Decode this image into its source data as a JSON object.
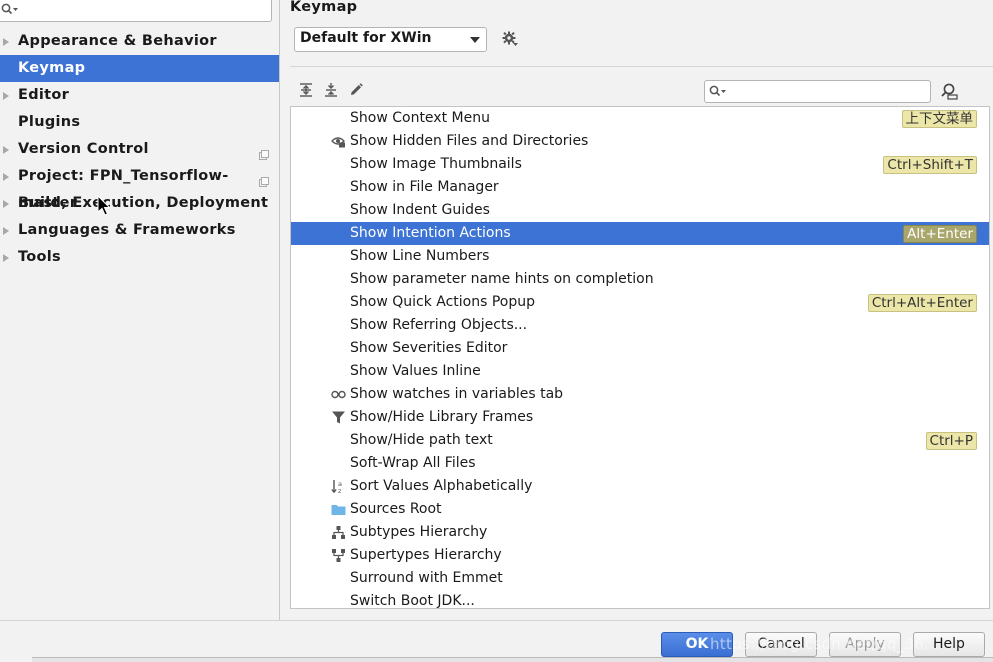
{
  "sidebar": {
    "search": {
      "value": "",
      "placeholder": ""
    },
    "items": [
      {
        "label": "Appearance & Behavior",
        "expandable": true
      },
      {
        "label": "Keymap",
        "selected": true
      },
      {
        "label": "Editor",
        "expandable": true
      },
      {
        "label": "Plugins"
      },
      {
        "label": "Version Control",
        "expandable": true,
        "project_icon": true
      },
      {
        "label": "Project: FPN_Tensorflow-master",
        "expandable": true,
        "project_icon": true
      },
      {
        "label": "Build, Execution, Deployment",
        "expandable": true
      },
      {
        "label": "Languages & Frameworks",
        "expandable": true
      },
      {
        "label": "Tools",
        "expandable": true
      }
    ]
  },
  "main": {
    "title": "Keymap",
    "keymap_select": {
      "value": "Default for XWin"
    },
    "filter": {
      "value": "",
      "placeholder": ""
    },
    "actions": [
      {
        "label": "Show Context Menu",
        "shortcut": "上下文菜单",
        "icon": ""
      },
      {
        "label": "Show Hidden Files and Directories",
        "shortcut": "",
        "icon": "hidden-files-icon"
      },
      {
        "label": "Show Image Thumbnails",
        "shortcut": "Ctrl+Shift+T",
        "icon": ""
      },
      {
        "label": "Show in File Manager",
        "shortcut": "",
        "icon": ""
      },
      {
        "label": "Show Indent Guides",
        "shortcut": "",
        "icon": ""
      },
      {
        "label": "Show Intention Actions",
        "shortcut": "Alt+Enter",
        "icon": "",
        "selected": true
      },
      {
        "label": "Show Line Numbers",
        "shortcut": "",
        "icon": ""
      },
      {
        "label": "Show parameter name hints on completion",
        "shortcut": "",
        "icon": ""
      },
      {
        "label": "Show Quick Actions Popup",
        "shortcut": "Ctrl+Alt+Enter",
        "icon": ""
      },
      {
        "label": "Show Referring Objects...",
        "shortcut": "",
        "icon": ""
      },
      {
        "label": "Show Severities Editor",
        "shortcut": "",
        "icon": ""
      },
      {
        "label": "Show Values Inline",
        "shortcut": "",
        "icon": ""
      },
      {
        "label": "Show watches in variables tab",
        "shortcut": "",
        "icon": "watches-icon"
      },
      {
        "label": "Show/Hide Library Frames",
        "shortcut": "",
        "icon": "filter-funnel-icon"
      },
      {
        "label": "Show/Hide path text",
        "shortcut": "Ctrl+P",
        "icon": ""
      },
      {
        "label": "Soft-Wrap All Files",
        "shortcut": "",
        "icon": ""
      },
      {
        "label": "Sort Values Alphabetically",
        "shortcut": "",
        "icon": "sort-alpha-icon"
      },
      {
        "label": "Sources Root",
        "shortcut": "",
        "icon": "folder-icon"
      },
      {
        "label": "Subtypes Hierarchy",
        "shortcut": "",
        "icon": "subtypes-hierarchy-icon"
      },
      {
        "label": "Supertypes Hierarchy",
        "shortcut": "",
        "icon": "supertypes-hierarchy-icon"
      },
      {
        "label": "Surround with Emmet",
        "shortcut": "",
        "icon": ""
      },
      {
        "label": "Switch Boot JDK...",
        "shortcut": "",
        "icon": ""
      }
    ]
  },
  "footer": {
    "ok_label": "OK",
    "cancel_label": "Cancel",
    "apply_label": "Apply",
    "help_label": "Help",
    "watermark": "https://blog.csdn.net/qq_36..."
  },
  "cursor": {
    "name": "mouse-pointer-icon"
  },
  "colors": {
    "selection": "#3d73d5",
    "shortcut_bg": "#ece7a9",
    "background": "#f2f2f2",
    "folder": "#6fb5e8"
  }
}
